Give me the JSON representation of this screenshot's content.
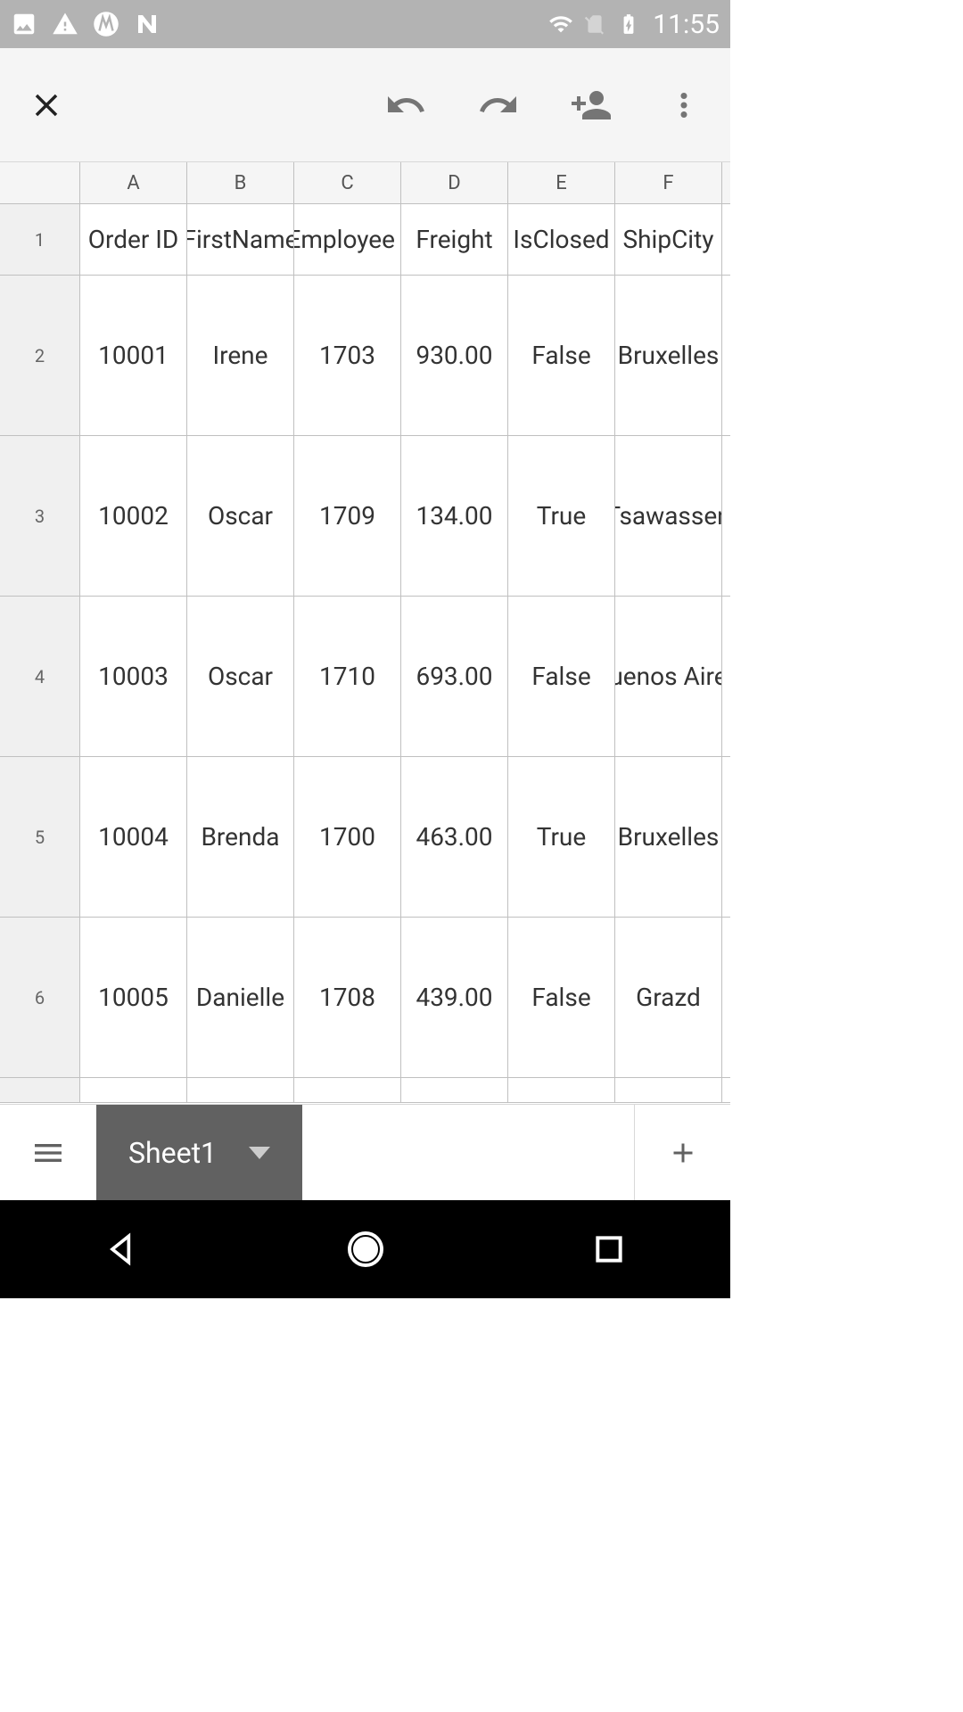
{
  "status_bar": {
    "time": "11:55"
  },
  "spreadsheet": {
    "columns": [
      "A",
      "B",
      "C",
      "D",
      "E",
      "F"
    ],
    "header_row": {
      "num": "1",
      "cells": [
        "Order ID",
        "FirstName",
        "Employee I",
        "Freight",
        "IsClosed",
        "ShipCity"
      ]
    },
    "data_rows": [
      {
        "num": "2",
        "cells": [
          "10001",
          "Irene",
          "1703",
          "930.00",
          "False",
          "Bruxelles"
        ]
      },
      {
        "num": "3",
        "cells": [
          "10002",
          "Oscar",
          "1709",
          "134.00",
          "True",
          "Tsawassen"
        ]
      },
      {
        "num": "4",
        "cells": [
          "10003",
          "Oscar",
          "1710",
          "693.00",
          "False",
          "uenos Aire"
        ]
      },
      {
        "num": "5",
        "cells": [
          "10004",
          "Brenda",
          "1700",
          "463.00",
          "True",
          "Bruxelles"
        ]
      },
      {
        "num": "6",
        "cells": [
          "10005",
          "Danielle",
          "1708",
          "439.00",
          "False",
          "Grazd"
        ]
      }
    ]
  },
  "sheet_tabs": {
    "active": "Sheet1"
  }
}
